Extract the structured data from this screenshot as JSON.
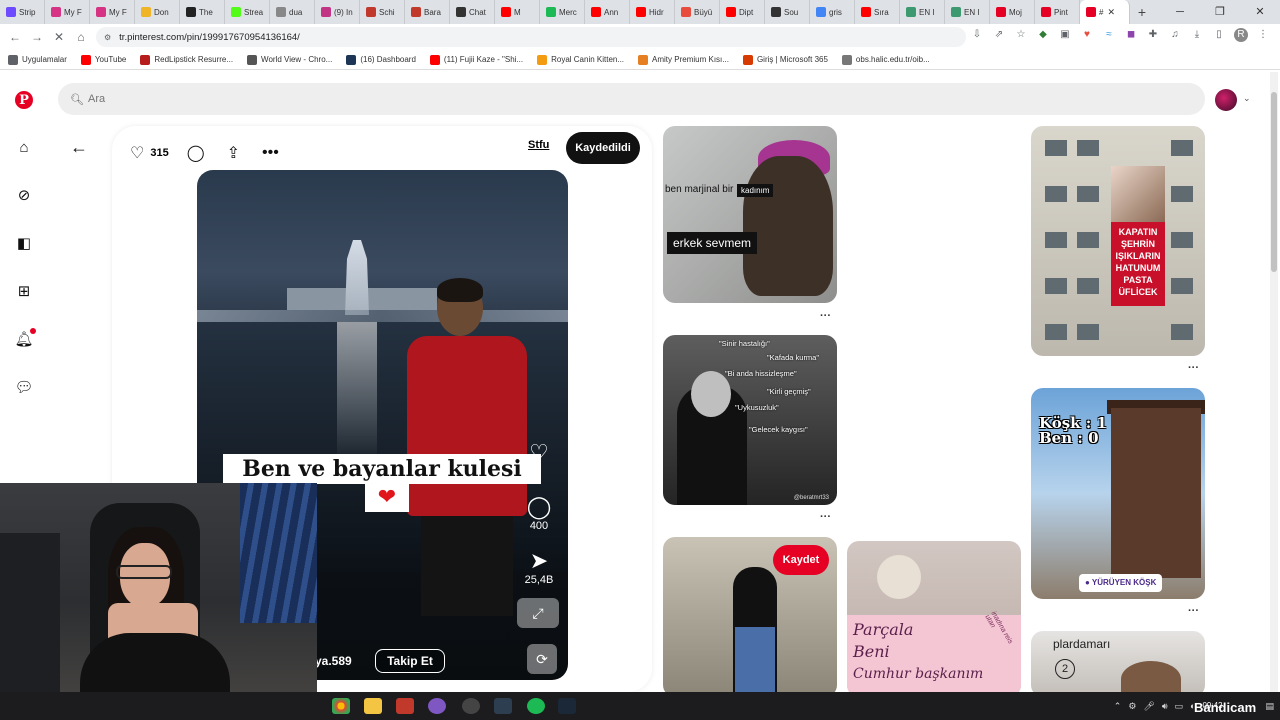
{
  "browser": {
    "tabs": [
      {
        "label": "Strip",
        "color": "#6d4aff"
      },
      {
        "label": "My F",
        "color": "#d63384"
      },
      {
        "label": "My F",
        "color": "#d63384"
      },
      {
        "label": "Don",
        "color": "#f0b429"
      },
      {
        "label": "The",
        "color": "#222222"
      },
      {
        "label": "Strea",
        "color": "#53fc18"
      },
      {
        "label": "dua",
        "color": "#888888"
      },
      {
        "label": "(9) In",
        "color": "#c13584"
      },
      {
        "label": "Schi",
        "color": "#c0392b"
      },
      {
        "label": "Bara",
        "color": "#c0392b"
      },
      {
        "label": "Chat",
        "color": "#333333"
      },
      {
        "label": "M",
        "color": "#ff0000"
      },
      {
        "label": "Merc",
        "color": "#1db954"
      },
      {
        "label": "Ann",
        "color": "#ff0000"
      },
      {
        "label": "Hidr",
        "color": "#ff0000"
      },
      {
        "label": "Büyü",
        "color": "#e74c3c"
      },
      {
        "label": "Dipt",
        "color": "#ff0000"
      },
      {
        "label": "Sou",
        "color": "#333333"
      },
      {
        "label": "gris",
        "color": "#4285f4"
      },
      {
        "label": "Sıra",
        "color": "#ff0000"
      },
      {
        "label": "EN I",
        "color": "#3d9970"
      },
      {
        "label": "EN I",
        "color": "#3d9970"
      },
      {
        "label": "Moj",
        "color": "#e60023"
      },
      {
        "label": "Pint",
        "color": "#e60023"
      },
      {
        "label": "#",
        "color": "#e60023",
        "active": true
      }
    ],
    "new_tab": "+",
    "url": "tr.pinterest.com/pin/199917670954136164/",
    "bookmarks": [
      {
        "label": "Uygulamalar",
        "color": "#5f6368"
      },
      {
        "label": "YouTube",
        "color": "#ff0000"
      },
      {
        "label": "RedLipstick Resurre...",
        "color": "#b71c1c"
      },
      {
        "label": "World View - Chro...",
        "color": "#555555"
      },
      {
        "label": "(16) Dashboard",
        "color": "#1d3557"
      },
      {
        "label": "(11) Fujii Kaze - \"Shi...",
        "color": "#ff0000"
      },
      {
        "label": "Royal Canin Kitten...",
        "color": "#f39c12"
      },
      {
        "label": "Amity Premium Kısı...",
        "color": "#e67e22"
      },
      {
        "label": "Giriş | Microsoft 365",
        "color": "#d83b01"
      },
      {
        "label": "obs.halic.edu.tr/oib...",
        "color": "#777777"
      }
    ]
  },
  "pinterest": {
    "search_placeholder": "Ara",
    "brand_color": "#e60023",
    "sidebar_icons": [
      "pinterest-logo",
      "home-icon",
      "explore-icon",
      "boards-icon",
      "create-icon",
      "notifications-icon",
      "messages-icon"
    ],
    "pin": {
      "like_count": "315",
      "board_name": "Stfu",
      "saved_label": "Kaydedildi",
      "caption": "Ben ve bayanlar kulesi",
      "video_comments": "400",
      "video_shares": "25,4B",
      "username": "ya.589",
      "follow_label": "Takip Et"
    },
    "feed": {
      "meme1_line1": "ben marjinal bir",
      "meme1_tag": "kadınım",
      "meme1_line2": "erkek sevmem",
      "meme2_labels": [
        "\"Sinir hastalığı\"",
        "\"Kafada kurma\"",
        "\"Bi anda hissizleşme\"",
        "\"Kirli geçmiş\"",
        "\"Uykusuzluk\"",
        "\"Gelecek kaygısı\""
      ],
      "meme2_credit": "@beratmrt33",
      "save_label": "Kaydet",
      "sign_text_1": "Parçala",
      "sign_text_2": "Beni",
      "sign_text_3": "Cumhur başkanım",
      "sign_side": "inadına reis utan",
      "banner_lines": [
        "KAPATIN",
        "ŞEHRİN",
        "IŞIKLARIN",
        "HATUNUM",
        "PASTA",
        "ÜFLİCEK"
      ],
      "kosk_line1": "Köşk : 1",
      "kosk_line2": "Ben : 0",
      "kosk_tag": "● YÜRÜYEN KÖŞK",
      "last_title": "plardamarı",
      "last_number": "2",
      "dots": "···"
    }
  },
  "taskbar": {
    "time": "09:42",
    "watermark": "Bandicam"
  }
}
